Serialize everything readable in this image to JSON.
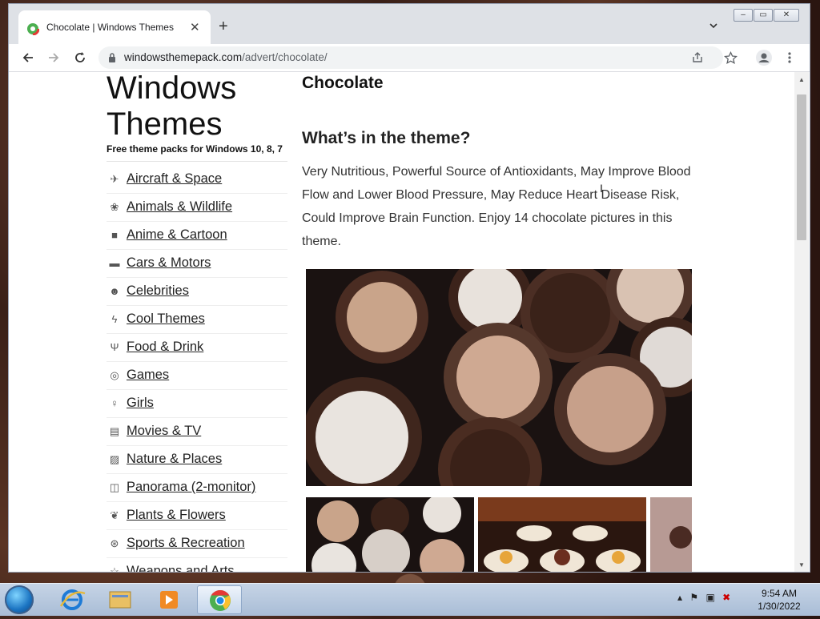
{
  "browser": {
    "tab": {
      "title": "Chocolate | Windows Themes",
      "close": "✕"
    },
    "new_tab": "+",
    "url": {
      "host": "windowsthemepack.com",
      "path": "/advert/chocolate/"
    },
    "window_controls": {
      "minimize": "–",
      "maximize": "▭",
      "close": "✕"
    }
  },
  "site": {
    "title_line1": "Windows",
    "title_line2": "Themes",
    "tagline": "Free theme packs for Windows 10, 8, 7"
  },
  "sidebar": {
    "categories": [
      {
        "label": "Aircraft & Space",
        "icon": "airplane-icon"
      },
      {
        "label": "Animals & Wildlife",
        "icon": "paw-icon"
      },
      {
        "label": "Anime & Cartoon",
        "icon": "video-camera-icon"
      },
      {
        "label": "Cars & Motors",
        "icon": "car-icon"
      },
      {
        "label": "Celebrities",
        "icon": "users-icon"
      },
      {
        "label": "Cool Themes",
        "icon": "lightning-icon"
      },
      {
        "label": "Food & Drink",
        "icon": "utensils-icon"
      },
      {
        "label": "Games",
        "icon": "gamepad-icon"
      },
      {
        "label": "Girls",
        "icon": "female-icon"
      },
      {
        "label": "Movies & TV",
        "icon": "film-icon"
      },
      {
        "label": "Nature & Places",
        "icon": "image-icon"
      },
      {
        "label": "Panorama (2-monitor)",
        "icon": "columns-icon"
      },
      {
        "label": "Plants & Flowers",
        "icon": "leaf-icon"
      },
      {
        "label": "Sports & Recreation",
        "icon": "basketball-icon"
      },
      {
        "label": "Weapons and Arts",
        "icon": "star-icon"
      }
    ]
  },
  "main": {
    "page_title": "Chocolate",
    "section_heading": "What’s in the theme?",
    "description": "Very Nutritious, Powerful Source of Antioxidants, May Improve Blood Flow and Lower Blood Pressure, May Reduce Heart Disease Risk, Could Improve Brain Function. Enjoy 14 chocolate pictures in this theme."
  },
  "taskbar": {
    "apps": [
      "internet-explorer-icon",
      "file-explorer-icon",
      "media-player-icon",
      "chrome-icon"
    ],
    "clock": {
      "time": "9:54 AM",
      "date": "1/30/2022"
    }
  },
  "colors": {
    "tab_strip": "#dee1e6",
    "link": "#222222",
    "taskbar": "#b9cbe0"
  }
}
